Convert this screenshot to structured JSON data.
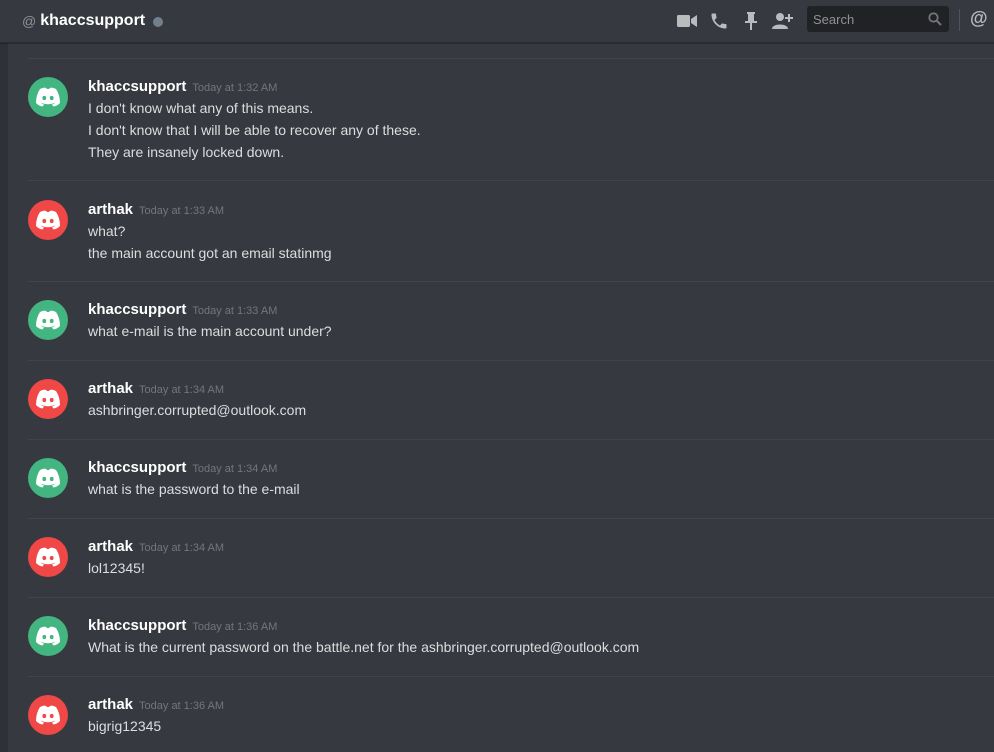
{
  "header": {
    "at_symbol": "@",
    "title": "khaccsupport",
    "search_placeholder": "Search",
    "mention_symbol": "@",
    "icons": [
      "video-call-icon",
      "voice-call-icon",
      "pin-icon",
      "add-friend-icon",
      "search-icon"
    ]
  },
  "colors": {
    "green_avatar": "#43b581",
    "red_avatar": "#f04747",
    "background": "#36393f",
    "header_text": "#ffffff",
    "timestamp": "#72767d"
  },
  "messages": [
    {
      "author": "khaccsupport",
      "timestamp": "Today at 1:32 AM",
      "avatar_color": "green",
      "lines": [
        "I don't know what any of this means.",
        "I don't know that I will be able to recover any of these.",
        "They are insanely locked down."
      ]
    },
    {
      "author": "arthak",
      "timestamp": "Today at 1:33 AM",
      "avatar_color": "red",
      "lines": [
        "what?",
        "the main account got an email statinmg"
      ]
    },
    {
      "author": "khaccsupport",
      "timestamp": "Today at 1:33 AM",
      "avatar_color": "green",
      "lines": [
        "what e-mail is the main account under?"
      ]
    },
    {
      "author": "arthak",
      "timestamp": "Today at 1:34 AM",
      "avatar_color": "red",
      "lines": [
        "ashbringer.corrupted@outlook.com"
      ]
    },
    {
      "author": "khaccsupport",
      "timestamp": "Today at 1:34 AM",
      "avatar_color": "green",
      "lines": [
        "what is the password to the e-mail"
      ]
    },
    {
      "author": "arthak",
      "timestamp": "Today at 1:34 AM",
      "avatar_color": "red",
      "lines": [
        "lol12345!"
      ]
    },
    {
      "author": "khaccsupport",
      "timestamp": "Today at 1:36 AM",
      "avatar_color": "green",
      "lines": [
        "What is the current password on the battle.net for the ashbringer.corrupted@outlook.com"
      ]
    },
    {
      "author": "arthak",
      "timestamp": "Today at 1:36 AM",
      "avatar_color": "red",
      "lines": [
        "bigrig12345"
      ]
    }
  ]
}
